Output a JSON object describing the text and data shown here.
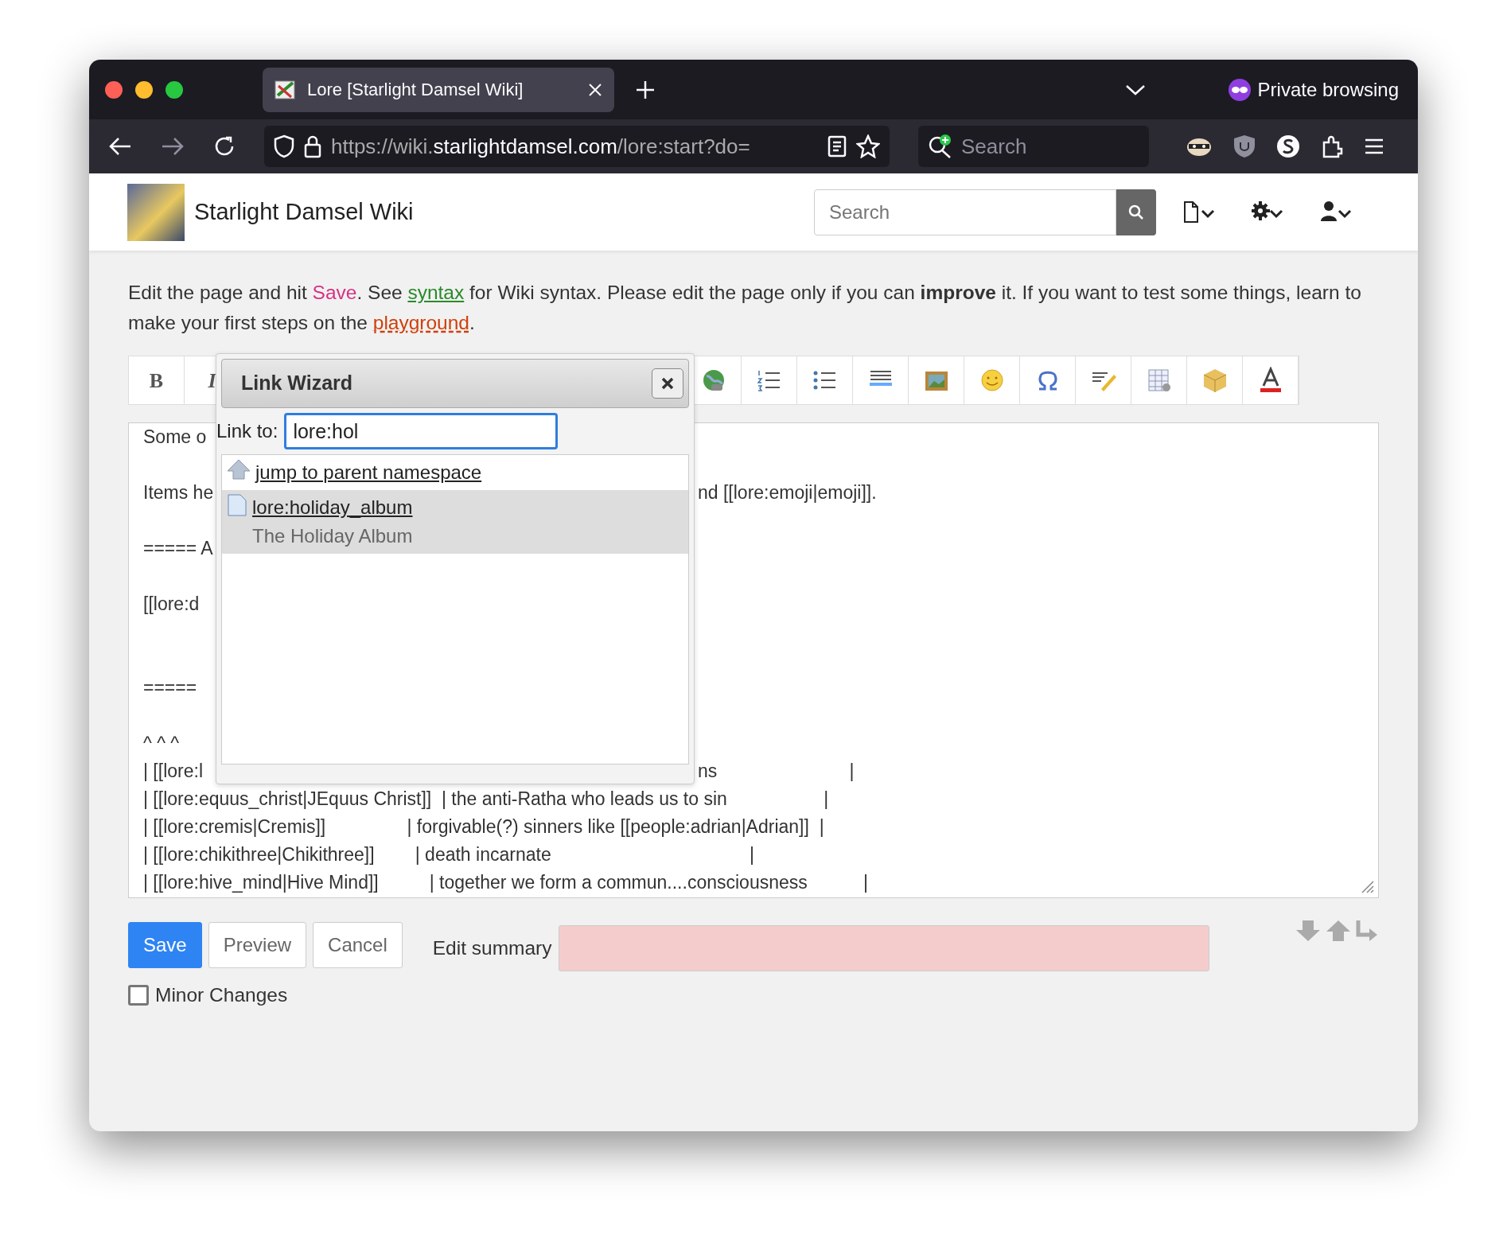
{
  "browser": {
    "tab": {
      "title": "Lore [Starlight Damsel Wiki]",
      "selected": true
    },
    "private_label": "Private browsing",
    "url": {
      "prefix": "https://wiki.",
      "domain": "starlightdamsel.com",
      "path": "/lore:start?do="
    },
    "search_placeholder": "Search"
  },
  "site": {
    "title": "Starlight Damsel Wiki",
    "search_placeholder": "Search"
  },
  "intro": [
    {
      "kind": "plain",
      "text": "Edit the page and hit "
    },
    {
      "kind": "term",
      "text": "Save"
    },
    {
      "kind": "plain",
      "text": ". See "
    },
    {
      "kind": "link",
      "text": "syntax"
    },
    {
      "kind": "plain",
      "text": " for Wiki syntax. Please edit the page only if you can **improve** it. If you want to test some things, learn to make your first steps on the "
    },
    {
      "kind": "wikilink",
      "text": "playground"
    },
    {
      "kind": "plain",
      "text": "."
    }
  ],
  "toolbar": [
    {
      "kind": "bold",
      "label": "B"
    },
    {
      "kind": "italic",
      "label": "I"
    },
    {
      "kind": "hidden"
    },
    {
      "kind": "globe"
    },
    {
      "kind": "ordered-list"
    },
    {
      "kind": "bullet-list"
    },
    {
      "kind": "rule"
    },
    {
      "kind": "image"
    },
    {
      "kind": "smiley"
    },
    {
      "kind": "omega"
    },
    {
      "kind": "signature"
    },
    {
      "kind": "table"
    },
    {
      "kind": "box"
    },
    {
      "kind": "font-color"
    }
  ],
  "editor": {
    "lines": [
      {
        "kind": "split",
        "left": "Some o"
      },
      {
        "kind": "blank"
      },
      {
        "kind": "split",
        "left": "Items he",
        "right": "nd [[lore:emoji|emoji]]."
      },
      {
        "kind": "blank"
      },
      {
        "kind": "split",
        "left": "===== A"
      },
      {
        "kind": "blank"
      },
      {
        "kind": "split",
        "left": "[[lore:d"
      },
      {
        "kind": "blank"
      },
      {
        "kind": "blank"
      },
      {
        "kind": "split",
        "left": "====="
      },
      {
        "kind": "blank"
      },
      {
        "kind": "split",
        "left": "^ ^ ^"
      },
      {
        "kind": "split",
        "left": "| [[lore:l",
        "right": "ns                          |"
      },
      {
        "kind": "full",
        "text": "| [[lore:equus_christ|JEquus Christ]]  | the anti-Ratha who leads us to sin                   |"
      },
      {
        "kind": "full",
        "text": "| [[lore:cremis|Cremis]]                | forgivable(?) sinners like [[people:adrian|Adrian]]  |"
      },
      {
        "kind": "full",
        "text": "| [[lore:chikithree|Chikithree]]        | death incarnate                                       |"
      },
      {
        "kind": "full",
        "text": "| [[lore:hive_mind|Hive Mind]]          | together we form a commun....consciousness           |"
      }
    ]
  },
  "link_wizard": {
    "title": "Link Wizard",
    "label": "Link to:",
    "value": "lore:hol",
    "results": [
      {
        "kind": "up",
        "title": "jump to parent namespace",
        "selected": false
      },
      {
        "kind": "page",
        "title": "lore:holiday_album",
        "subtitle": "The Holiday Album",
        "selected": true
      }
    ]
  },
  "actions": {
    "buttons": [
      {
        "kind": "primary",
        "label": "Save"
      },
      {
        "kind": "secondary",
        "label": "Preview"
      },
      {
        "kind": "secondary",
        "label": "Cancel"
      }
    ],
    "summary_label": "Edit summary",
    "summary_required_empty": true,
    "minor": {
      "label": "Minor Changes",
      "checked": false
    }
  }
}
